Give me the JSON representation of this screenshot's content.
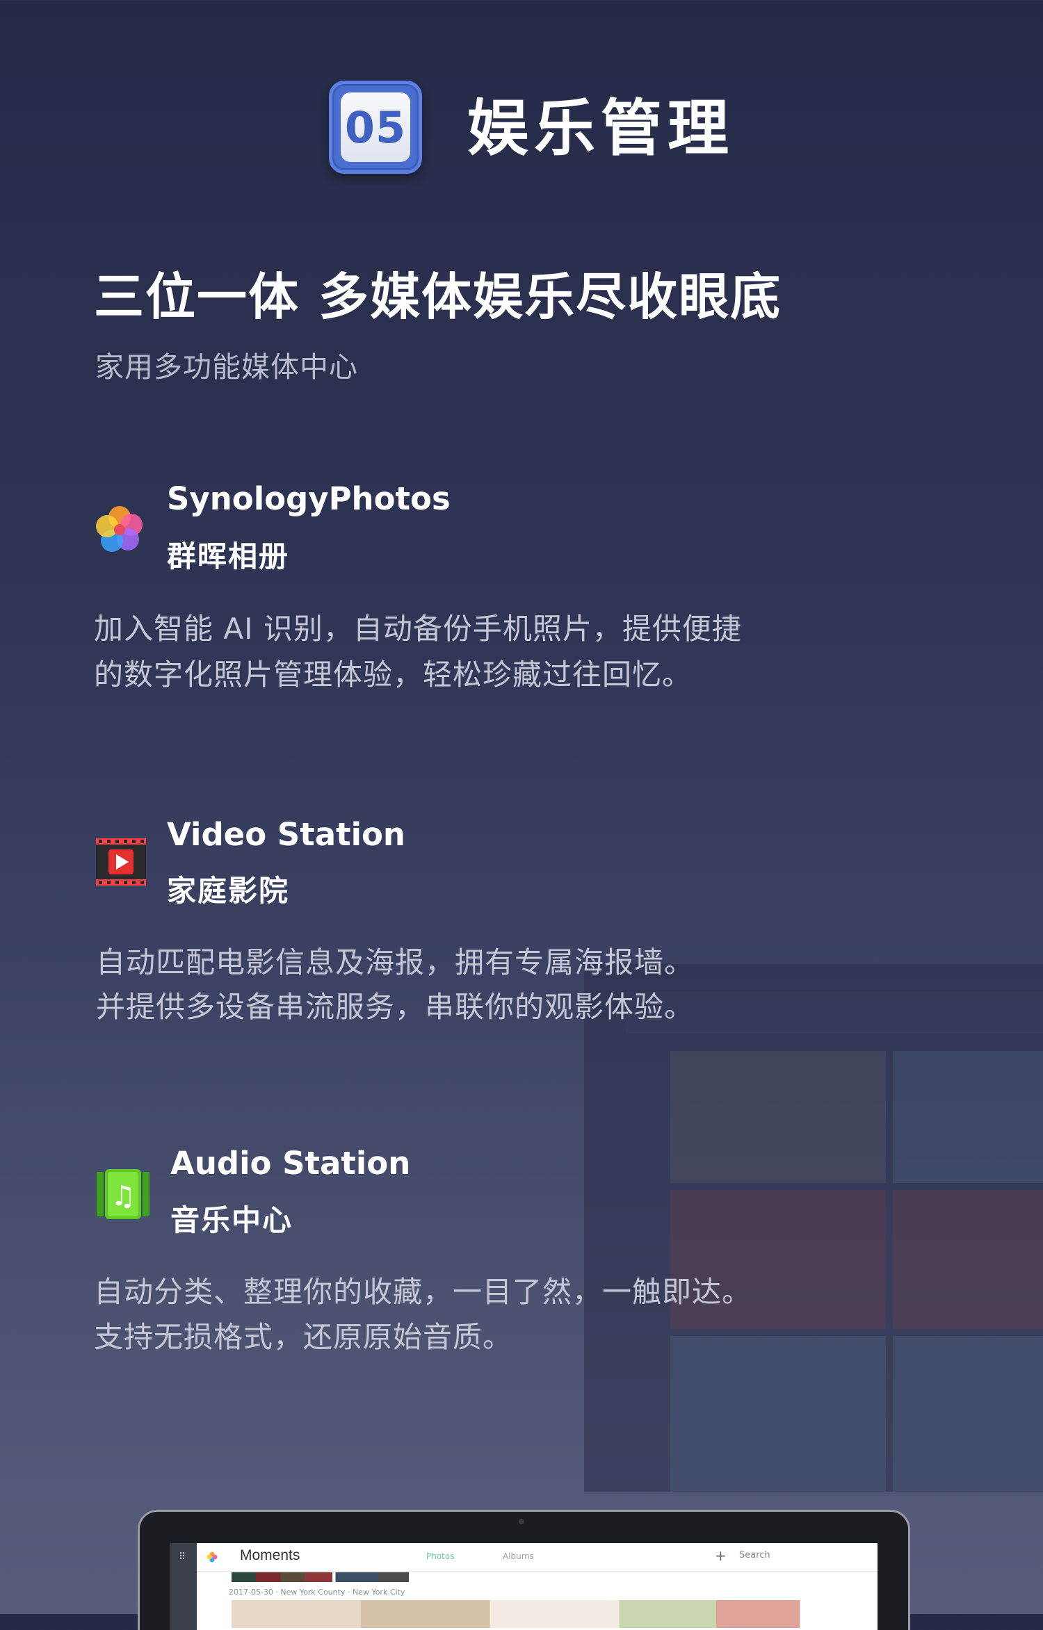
{
  "header": {
    "badge_number": "05",
    "title": "娱乐管理"
  },
  "intro": {
    "headline": "三位一体 多媒体娱乐尽收眼底",
    "subtitle": "家用多功能媒体中心"
  },
  "features": [
    {
      "icon": "photos-flower-icon",
      "name": "SynologyPhotos",
      "name_cn": "群晖相册",
      "desc_lines": [
        "加入智能 AI 识别，自动备份手机照片，提供便捷",
        "的数字化照片管理体验，轻松珍藏过往回忆。"
      ]
    },
    {
      "icon": "video-play-icon",
      "name": "Video Station",
      "name_cn": "家庭影院",
      "desc_lines": [
        "自动匹配电影信息及海报，拥有专属海报墙。",
        "并提供多设备串流服务，串联你的观影体验。"
      ]
    },
    {
      "icon": "music-note-icon",
      "name": "Audio Station",
      "name_cn": "音乐中心",
      "desc_lines": [
        "自动分类、整理你的收藏，一目了然，一触即达。",
        "支持无损格式，还原原始音质。"
      ]
    }
  ],
  "laptop_screen": {
    "app_title": "Moments",
    "tab_photos": "Photos",
    "tab_albums": "Albums",
    "search_placeholder": "Search",
    "date_line": "2017-05-30 · New York County · New York City"
  },
  "colors": {
    "background_top": "#252b47",
    "background_bottom": "#565d79",
    "badge_blue": "#4a6fd1",
    "desc_text": "#c3c7d6"
  }
}
